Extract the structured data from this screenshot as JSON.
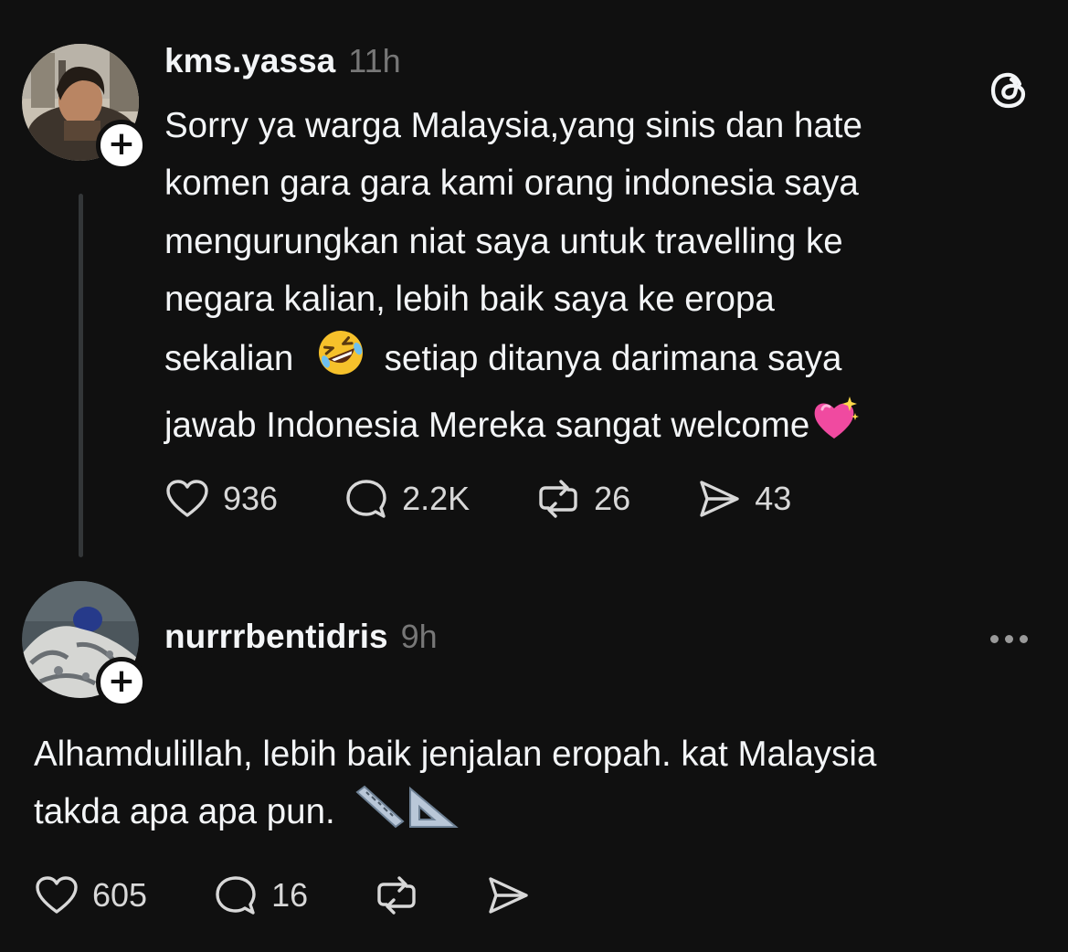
{
  "post": {
    "username": "kms.yassa",
    "timestamp": "11h",
    "lines": [
      "Sorry ya warga Malaysia,yang sinis dan hate",
      "komen gara gara kami orang indonesia saya",
      "mengurungkan niat saya untuk travelling ke",
      "negara kalian, lebih baik saya ke eropa",
      "sekalian",
      "setiap ditanya darimana saya",
      "jawab Indonesia Mereka sangat welcome"
    ],
    "emoji_laughing": "rolling-on-floor-laughing-emoji",
    "emoji_heart": "sparkling-heart-emoji",
    "likes": "936",
    "replies": "2.2K",
    "reposts": "26",
    "shares": "43"
  },
  "reply": {
    "username": "nurrrbentidris",
    "timestamp": "9h",
    "lines": [
      "Alhamdulillah, lebih baik jenjalan eropah. kat Malaysia",
      "takda apa apa pun."
    ],
    "emoji_ruler": "straight-ruler-emoji",
    "emoji_triangle": "triangular-ruler-emoji",
    "likes": "605",
    "replies": "16"
  },
  "icons": {
    "app": "threads-logo-icon",
    "like": "heart-icon",
    "reply": "comment-icon",
    "repost": "repost-icon",
    "share": "send-icon",
    "more": "more-icon",
    "follow": "plus-icon"
  },
  "colors": {
    "background": "#101010",
    "text": "#f3f5f7",
    "muted": "#777777",
    "thread_line": "#333638"
  }
}
